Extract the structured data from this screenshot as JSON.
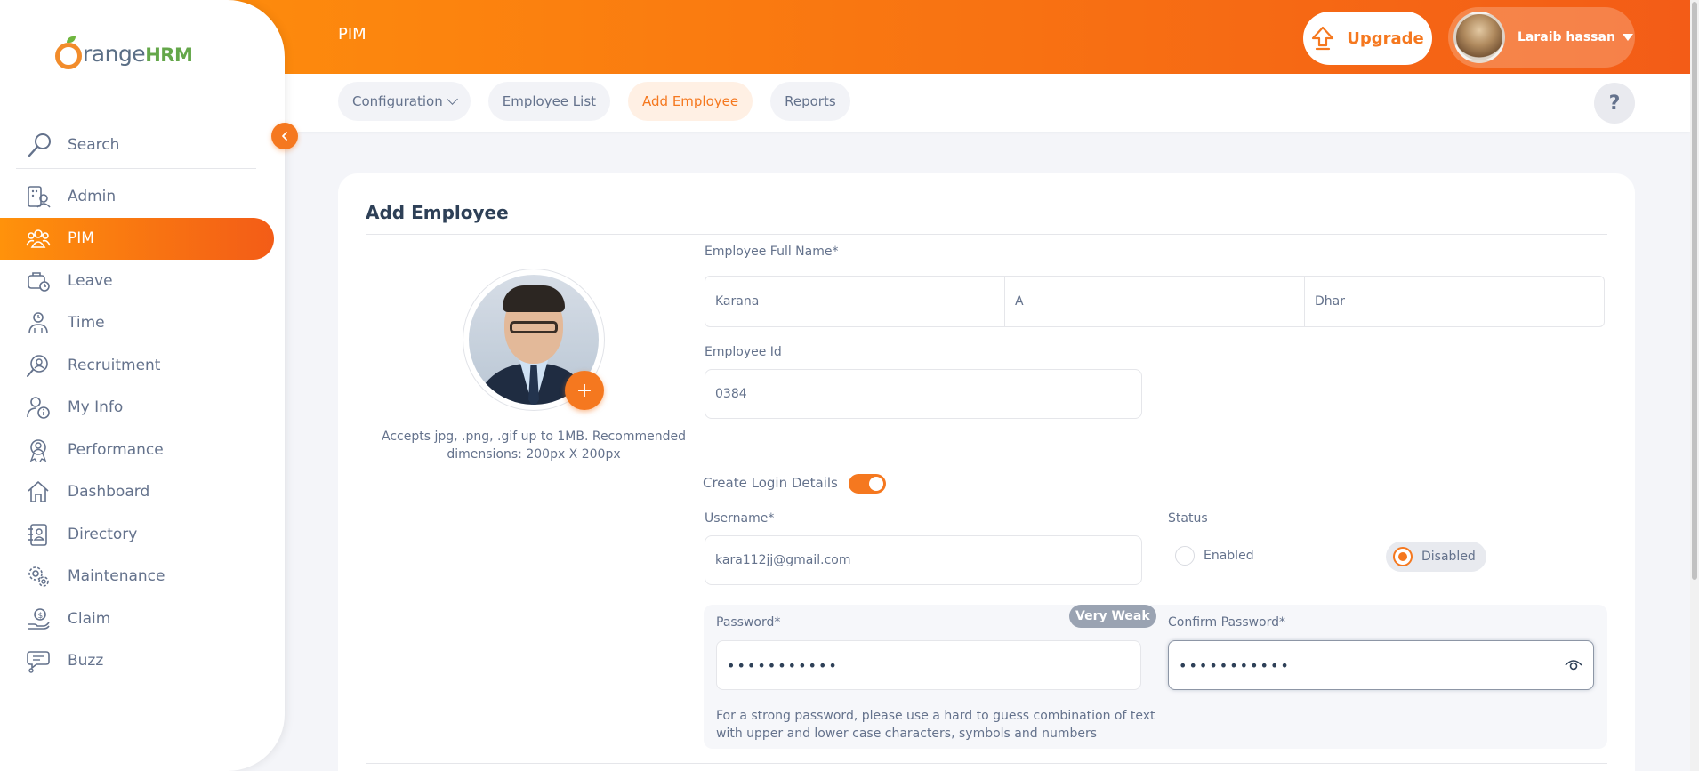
{
  "brand": {
    "text": "range",
    "hrm": "HRM"
  },
  "sidebar": {
    "search_label": "Search",
    "items": [
      {
        "label": "Admin",
        "icon": "admin-icon",
        "active": false
      },
      {
        "label": "PIM",
        "icon": "pim-icon",
        "active": true
      },
      {
        "label": "Leave",
        "icon": "leave-icon",
        "active": false
      },
      {
        "label": "Time",
        "icon": "time-icon",
        "active": false
      },
      {
        "label": "Recruitment",
        "icon": "recruitment-icon",
        "active": false
      },
      {
        "label": "My Info",
        "icon": "my-info-icon",
        "active": false
      },
      {
        "label": "Performance",
        "icon": "performance-icon",
        "active": false
      },
      {
        "label": "Dashboard",
        "icon": "dashboard-icon",
        "active": false
      },
      {
        "label": "Directory",
        "icon": "directory-icon",
        "active": false
      },
      {
        "label": "Maintenance",
        "icon": "maintenance-icon",
        "active": false
      },
      {
        "label": "Claim",
        "icon": "claim-icon",
        "active": false
      },
      {
        "label": "Buzz",
        "icon": "buzz-icon",
        "active": false
      }
    ]
  },
  "header": {
    "module_title": "PIM",
    "upgrade_label": "Upgrade",
    "user_name": "Laraib hassan"
  },
  "tabs": [
    {
      "label": "Configuration",
      "has_caret": true,
      "active": false
    },
    {
      "label": "Employee List",
      "has_caret": false,
      "active": false
    },
    {
      "label": "Add Employee",
      "has_caret": false,
      "active": true
    },
    {
      "label": "Reports",
      "has_caret": false,
      "active": false
    }
  ],
  "help_label": "?",
  "form": {
    "title": "Add Employee",
    "photo_add_label": "+",
    "photo_hint": "Accepts jpg, .png, .gif up to 1MB. Recommended dimensions: 200px X 200px",
    "full_name_label": "Employee Full Name*",
    "first_name": "Karana",
    "middle_name": "A",
    "last_name": "Dhar",
    "employee_id_label": "Employee Id",
    "employee_id": "0384",
    "create_login_label": "Create Login Details",
    "create_login_enabled": true,
    "username_label": "Username*",
    "username": "kara112jj@gmail.com",
    "status_label": "Status",
    "status_options": [
      "Enabled",
      "Disabled"
    ],
    "status_selected": "Disabled",
    "password_label": "Password*",
    "password_strength": "Very Weak",
    "password_masked": "•••••••••••",
    "confirm_password_label": "Confirm Password*",
    "confirm_password_masked": "•••••••••••",
    "password_hint": "For a strong password, please use a hard to guess combination of text with upper and lower case characters, symbols and numbers"
  },
  "colors": {
    "accent": "#f5781f",
    "accent_gradient_start": "#ff920b",
    "accent_gradient_end": "#f35c17",
    "text": "#64728c",
    "title": "#2e4057"
  }
}
